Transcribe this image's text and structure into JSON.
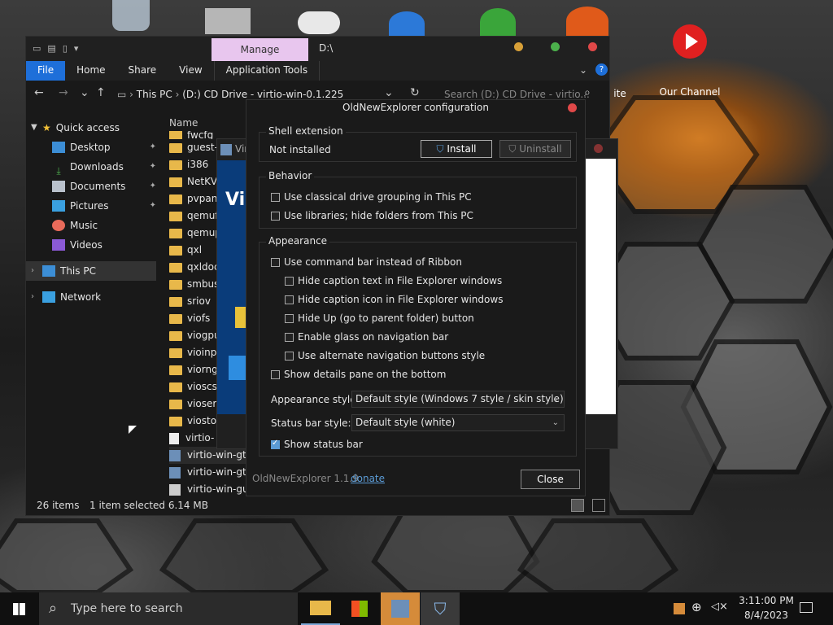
{
  "desktop": {
    "icons": [
      {
        "label": "Our Channel"
      },
      {
        "label": "ite"
      }
    ]
  },
  "explorer": {
    "manage_tab": "Manage",
    "window_title": "D:\\",
    "ribbon": [
      "File",
      "Home",
      "Share",
      "View",
      "Application Tools"
    ],
    "address": [
      "This PC",
      "(D:) CD Drive - virtio-win-0.1.225"
    ],
    "search_placeholder": "Search (D:) CD Drive - virtio...",
    "column_name": "Name",
    "sidebar": {
      "quick_access": "Quick access",
      "items": [
        {
          "label": "Desktop"
        },
        {
          "label": "Downloads"
        },
        {
          "label": "Documents"
        },
        {
          "label": "Pictures"
        },
        {
          "label": "Music"
        },
        {
          "label": "Videos"
        }
      ],
      "this_pc": "This PC",
      "network": "Network"
    },
    "files": [
      "fwcfg",
      "guest-",
      "i386",
      "NetKV",
      "pvpan",
      "qemuf",
      "qemup",
      "qxl",
      "qxldoc",
      "smbus",
      "sriov",
      "viofs",
      "viogpu",
      "vioinp",
      "viorng",
      "vioscs",
      "vioser",
      "viosto",
      "virtio-",
      "virtio-win-gt-",
      "virtio-win-gt-",
      "virtio-win-gue"
    ],
    "status": {
      "count": "26 items",
      "selected": "1 item selected  6.14 MB"
    }
  },
  "installer": {
    "title": "Virt",
    "side_text": "Vi"
  },
  "config": {
    "title": "OldNewExplorer configuration",
    "shell": {
      "label": "Shell extension",
      "status": "Not installed",
      "install": "Install",
      "uninstall": "Uninstall"
    },
    "behavior": {
      "label": "Behavior",
      "opts": [
        {
          "label": "Use classical drive grouping in This PC",
          "checked": false
        },
        {
          "label": "Use libraries; hide folders from This PC",
          "checked": false
        }
      ]
    },
    "appearance": {
      "label": "Appearance",
      "opts": [
        {
          "label": "Use command bar instead of Ribbon",
          "checked": false
        },
        {
          "label": "Hide caption text in File Explorer windows",
          "checked": false
        },
        {
          "label": "Hide caption icon in File Explorer windows",
          "checked": false
        },
        {
          "label": "Hide Up (go to parent folder) button",
          "checked": false
        },
        {
          "label": "Enable glass on navigation bar",
          "checked": false
        },
        {
          "label": "Use alternate navigation buttons style",
          "checked": false
        },
        {
          "label": "Show details pane on the bottom",
          "checked": false
        }
      ],
      "style_label": "Appearance style:",
      "style_value": "Default style (Windows 7 style / skin style)",
      "status_label": "Status bar style:",
      "status_value": "Default style (white)",
      "show_status": "Show status bar",
      "show_status_checked": true
    },
    "footer": {
      "version": "OldNewExplorer 1.1.9",
      "donate": "donate",
      "close": "Close"
    }
  },
  "taskbar": {
    "search_placeholder": "Type here to search",
    "time": "3:11:00 PM",
    "date": "8/4/2023"
  },
  "colors": {
    "accent": "#1e6fd9",
    "manage": "#e8c6ee",
    "active_app": "#d58b3a"
  }
}
